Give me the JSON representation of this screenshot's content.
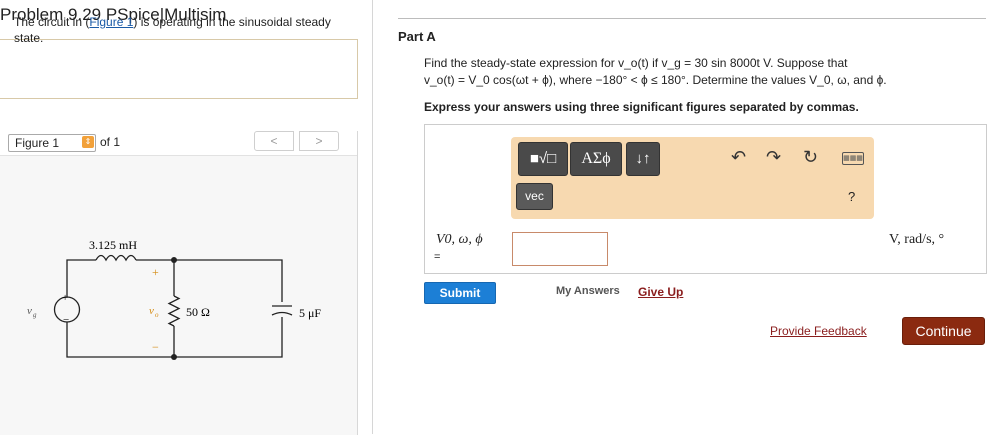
{
  "page": {
    "title": "Problem 9.29 PSpice|Multisim"
  },
  "intro": {
    "prefix": "The circuit in (",
    "link": "Figure 1",
    "suffix": ") is operating in the sinusoidal steady state."
  },
  "figure": {
    "select_label": "Figure 1",
    "of_text": "of 1",
    "prev": "<",
    "next": ">",
    "circuit": {
      "inductor": "3.125 mH",
      "source": "v",
      "source_sub": "g",
      "resistor": "50 Ω",
      "capacitor": "5 μF",
      "vo": "v",
      "vo_sub": "o",
      "plus": "+",
      "minus": "−"
    }
  },
  "part": {
    "label": "Part A",
    "question_line1": "Find the steady-state expression for v_o(t) if v_g = 30 sin 8000t V. Suppose that",
    "question_line2": "v_o(t) = V_0 cos(ωt + ϕ), where −180° < ϕ ≤ 180°. Determine the values V_0, ω, and ϕ.",
    "instruction": "Express your answers using three significant figures separated by commas."
  },
  "toolbar": {
    "templates": "■√□",
    "greek": "ΑΣϕ",
    "arrows": "↓↑",
    "vec": "vec",
    "help": "?"
  },
  "answer": {
    "label": "V0, ω, ϕ",
    "equals": "=",
    "value": "",
    "units": "V, rad/s, °"
  },
  "actions": {
    "submit": "Submit",
    "my_answers": "My Answers",
    "give_up": "Give Up",
    "feedback": "Provide Feedback",
    "continue": "Continue"
  }
}
